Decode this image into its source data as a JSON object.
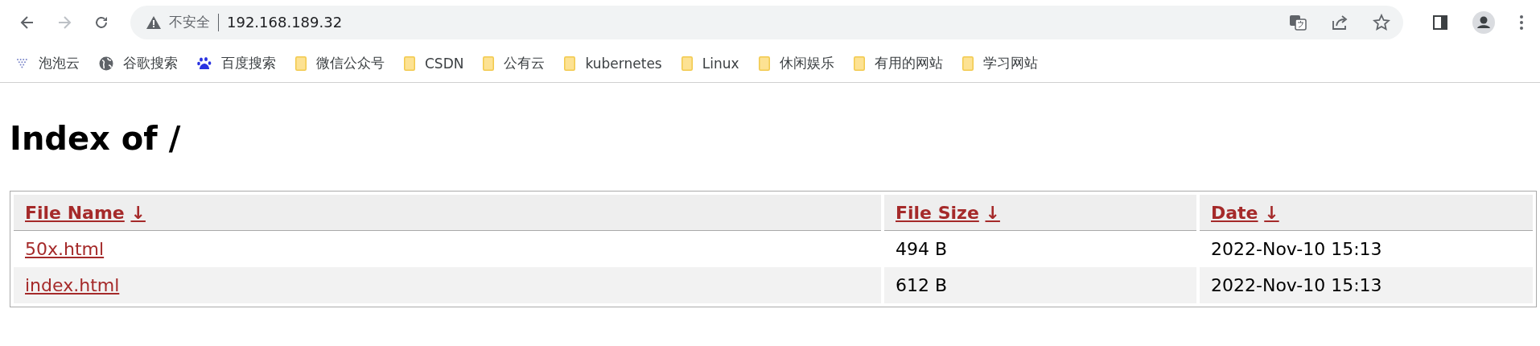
{
  "address_bar": {
    "security": "不安全",
    "url": "192.168.189.32"
  },
  "bookmarks": [
    {
      "kind": "dots",
      "label": "泡泡云"
    },
    {
      "kind": "globe",
      "label": "谷歌搜索"
    },
    {
      "kind": "paw",
      "label": "百度搜索"
    },
    {
      "kind": "folder",
      "label": "微信公众号"
    },
    {
      "kind": "folder",
      "label": "CSDN"
    },
    {
      "kind": "folder",
      "label": "公有云"
    },
    {
      "kind": "folder",
      "label": "kubernetes"
    },
    {
      "kind": "folder",
      "label": "Linux"
    },
    {
      "kind": "folder",
      "label": "休闲娱乐"
    },
    {
      "kind": "folder",
      "label": "有用的网站"
    },
    {
      "kind": "folder",
      "label": "学习网站"
    }
  ],
  "heading": "Index of /",
  "table": {
    "columns": [
      {
        "label": "File Name",
        "sort": "↓"
      },
      {
        "label": "File Size",
        "sort": "↓"
      },
      {
        "label": "Date",
        "sort": "↓"
      }
    ],
    "rows": [
      {
        "name": "50x.html",
        "size": "494 B",
        "date": "2022-Nov-10 15:13"
      },
      {
        "name": "index.html",
        "size": "612 B",
        "date": "2022-Nov-10 15:13"
      }
    ]
  }
}
